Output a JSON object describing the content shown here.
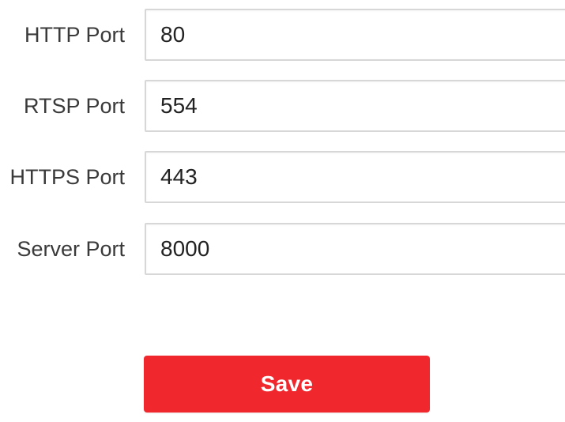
{
  "ports": [
    {
      "label": "HTTP Port",
      "value": "80"
    },
    {
      "label": "RTSP Port",
      "value": "554"
    },
    {
      "label": "HTTPS Port",
      "value": "443"
    },
    {
      "label": "Server Port",
      "value": "8000"
    }
  ],
  "actions": {
    "save_label": "Save"
  },
  "colors": {
    "save_button_bg": "#f0282d",
    "input_border": "#d7d7d7",
    "label_text": "#3a3a3a"
  }
}
